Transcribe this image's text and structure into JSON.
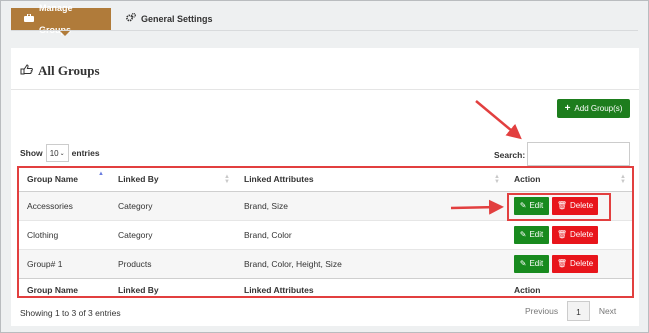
{
  "tabs": [
    {
      "label": "Manage Groups",
      "icon": "briefcase-icon",
      "active": true
    },
    {
      "label": "General Settings",
      "icon": "cogs-icon",
      "active": false
    }
  ],
  "panel": {
    "title": "All Groups",
    "title_icon": "hand-pointing-icon",
    "add_button": "Add Group(s)",
    "show_prefix": "Show",
    "show_value": "10",
    "show_suffix": "entries",
    "search_label": "Search:",
    "search_value": ""
  },
  "table": {
    "columns": [
      "Group Name",
      "Linked By",
      "Linked Attributes",
      "Action"
    ],
    "rows": [
      {
        "name": "Accessories",
        "linked_by": "Category",
        "attributes": "Brand, Size",
        "edit": "Edit",
        "delete": "Delete"
      },
      {
        "name": "Clothing",
        "linked_by": "Category",
        "attributes": "Brand, Color",
        "edit": "Edit",
        "delete": "Delete"
      },
      {
        "name": "Group# 1",
        "linked_by": "Products",
        "attributes": "Brand, Color, Height, Size",
        "edit": "Edit",
        "delete": "Delete"
      }
    ]
  },
  "footer": {
    "info": "Showing 1 to 3 of 3 entries",
    "previous": "Previous",
    "page": "1",
    "next": "Next"
  },
  "colors": {
    "tab_active": "#b07b3a",
    "add_button": "#1d7d1d",
    "edit_button": "#188a1e",
    "delete_button": "#e8151b",
    "annotation": "#e23f3f"
  }
}
